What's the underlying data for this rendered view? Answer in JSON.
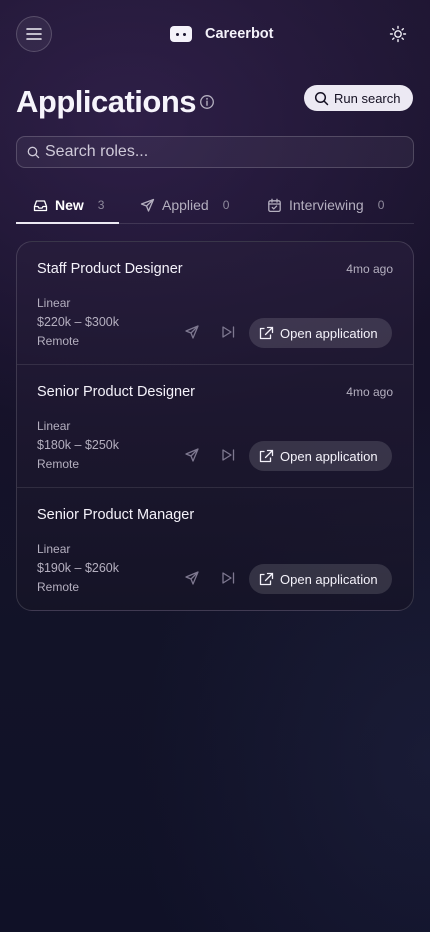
{
  "app": {
    "name": "Careerbot"
  },
  "header": {
    "title": "Applications",
    "run_search_label": "Run search"
  },
  "search": {
    "placeholder": "Search roles..."
  },
  "tabs": [
    {
      "label": "New",
      "count": "3",
      "active": true,
      "icon": "inbox-icon"
    },
    {
      "label": "Applied",
      "count": "0",
      "active": false,
      "icon": "send-icon"
    },
    {
      "label": "Interviewing",
      "count": "0",
      "active": false,
      "icon": "calendar-icon"
    }
  ],
  "applications": [
    {
      "title": "Staff Product Designer",
      "time": "4mo ago",
      "company": "Linear",
      "salary": "$220k – $300k",
      "location": "Remote",
      "action_label": "Open application"
    },
    {
      "title": "Senior Product Designer",
      "time": "4mo ago",
      "company": "Linear",
      "salary": "$180k – $250k",
      "location": "Remote",
      "action_label": "Open application"
    },
    {
      "title": "Senior Product Manager",
      "time": "",
      "company": "Linear",
      "salary": "$190k – $260k",
      "location": "Remote",
      "action_label": "Open application"
    }
  ],
  "icons": {
    "menu": "menu-icon",
    "theme": "sun-icon",
    "info": "info-icon",
    "search": "search-icon",
    "send": "send-icon",
    "skip": "skip-forward-icon",
    "external": "external-link-icon"
  },
  "colors": {
    "background": "#17122a",
    "accent": "#ece9f3",
    "muted": "#b4afbf"
  }
}
